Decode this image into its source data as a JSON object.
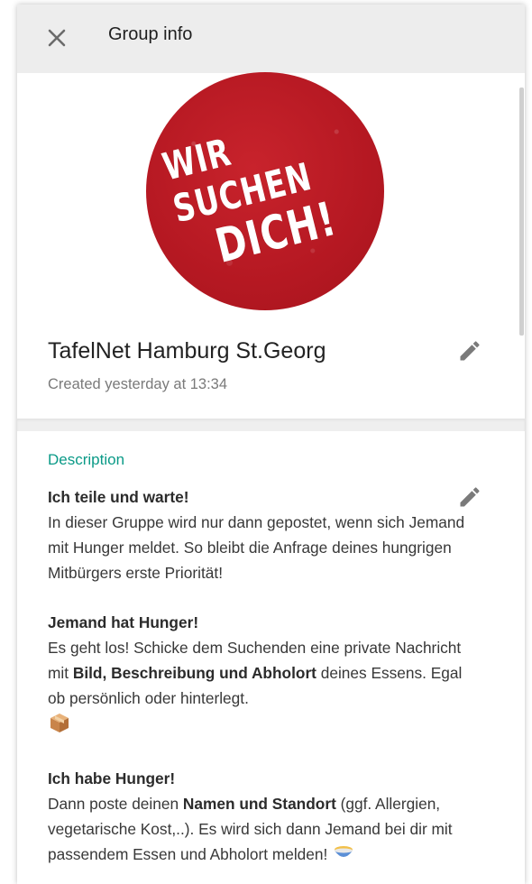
{
  "header": {
    "title": "Group info",
    "close_icon": "close-icon"
  },
  "avatar": {
    "line1": "WIR SUCHEN",
    "line2": "DICH!",
    "color": "#b51822"
  },
  "group": {
    "name": "TafelNet Hamburg St.Georg",
    "created": "Created yesterday at 13:34",
    "edit_icon": "pencil-icon"
  },
  "description": {
    "label": "Description",
    "label_color": "#0a9a87",
    "edit_icon": "pencil-icon",
    "sections": [
      {
        "heading": "Ich teile und warte!",
        "text": "In dieser Gruppe wird nur dann gepostet, wenn sich Jemand mit Hunger meldet. So bleibt die Anfrage deines hungrigen Mitbürgers erste Priorität!"
      },
      {
        "heading": "Jemand hat Hunger!",
        "text_a": "Es geht los! Schicke dem Suchenden eine private Nachricht mit ",
        "bold": "Bild, Beschreibung und Abholort",
        "text_b": " deines Essens. Egal ob persönlich oder hinterlegt.",
        "emoji": "package-icon"
      },
      {
        "heading": "Ich habe Hunger!",
        "text_a": "Dann poste deinen ",
        "bold": "Namen und Standort",
        "text_b": " (ggf. Allergien, vegetarische Kost,..). Es wird sich dann Jemand bei dir mit passendem Essen und Abholort melden! ",
        "emoji": "bowl-icon"
      }
    ]
  }
}
